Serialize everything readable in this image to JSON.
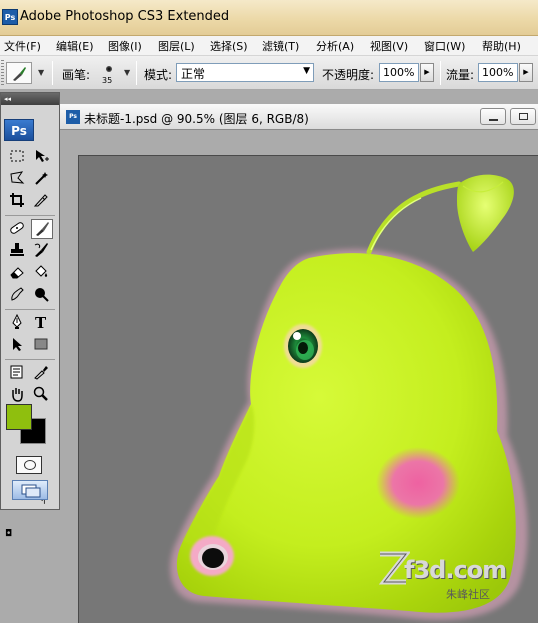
{
  "app": {
    "logo": "Ps",
    "title": "Adobe Photoshop CS3 Extended"
  },
  "menu": [
    "文件(F)",
    "编辑(E)",
    "图像(I)",
    "图层(L)",
    "选择(S)",
    "滤镜(T)",
    "分析(A)",
    "视图(V)",
    "窗口(W)",
    "帮助(H)"
  ],
  "options": {
    "brush_label": "画笔:",
    "brush_size": "35",
    "mode_label": "模式:",
    "mode_value": "正常",
    "opacity_label": "不透明度:",
    "opacity_value": "100%",
    "flow_label": "流量:",
    "flow_value": "100%"
  },
  "tools": {
    "logo": "Ps",
    "foreground_color": "#8fbf0e",
    "background_color": "#000000"
  },
  "document": {
    "title": "未标题-1.psd @ 90.5% (图层 6, RGB/8)"
  },
  "watermark": {
    "brand": "f3d.com",
    "sub": "朱峰社区"
  },
  "colors": {
    "canvas_gray": "#777777",
    "body_green": "#c8f21c",
    "cheek_pink": "#ee5aa8"
  }
}
